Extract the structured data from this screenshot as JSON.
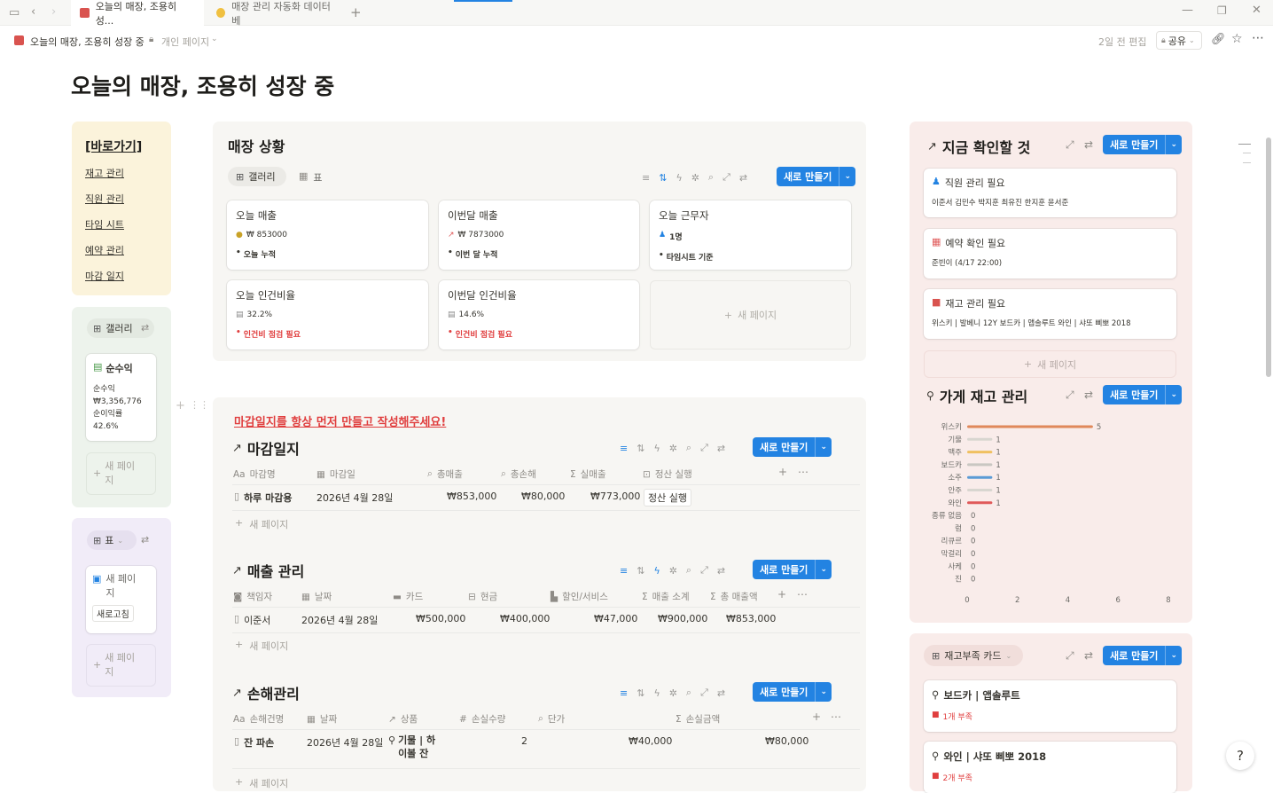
{
  "tabs": [
    {
      "label": "오늘의 매장, 조용히 성...",
      "active": true
    },
    {
      "label": "매장 관리 자동화 데이터베",
      "active": false
    }
  ],
  "topbar": {
    "page": "오늘의 매장, 조용히 성장 중",
    "privacy": "개인 페이지",
    "edited": "2일 전 편집",
    "share": "공유"
  },
  "title": "오늘의 매장, 조용히 성장 중",
  "shortcuts": {
    "heading": "[바로가기]",
    "links": [
      "재고 관리",
      "직원 관리",
      "타임 시트",
      "예약 관리",
      "마감 일지"
    ]
  },
  "gallery1": {
    "view": "갤러리",
    "card_title": "순수익",
    "lines": [
      "순수익",
      "₩3,356,776",
      "순이익률",
      "42.6%"
    ],
    "new": "새 페이\n지"
  },
  "gallery2": {
    "view": "표",
    "card_title": "새 페이\n지",
    "refresh": "새로고침",
    "new": "새 페이\n지"
  },
  "status": {
    "heading": "매장 상황",
    "views": [
      "갤러리",
      "표"
    ],
    "new_btn": "새로 만들기",
    "cards": [
      {
        "title": "오늘 매출",
        "value": "₩ 853000",
        "note": "오늘 누적",
        "alert": false,
        "icon": "coin-icon"
      },
      {
        "title": "이번달 매출",
        "value": "₩ 7873000",
        "note": "이번 달 누적",
        "alert": false,
        "icon": "chart-up-icon"
      },
      {
        "title": "오늘 근무자",
        "value": "1명",
        "note": "타임시트 기준",
        "alert": false,
        "icon": "people-icon"
      },
      {
        "title": "오늘 인건비율",
        "value": "32.2%",
        "note": "인건비 점검 필요",
        "alert": true,
        "icon": "memo-icon"
      },
      {
        "title": "이번달 인건비율",
        "value": "14.6%",
        "note": "인건비 점검 필요",
        "alert": true,
        "icon": "memo-icon"
      }
    ],
    "new_page": "새 페이지"
  },
  "notice": "마감일지를 항상 먼저 만들고 작성해주세요!",
  "closing": {
    "heading": "마감일지",
    "new_btn": "새로 만들기",
    "cols": [
      "마감명",
      "마감일",
      "총매출",
      "총손해",
      "실매출",
      "정산 실행"
    ],
    "row": [
      "하루 마감용",
      "2026년 4월 28일",
      "₩853,000",
      "₩80,000",
      "₩773,000",
      "정산 실행"
    ],
    "new_page": "새 페이지"
  },
  "sales": {
    "heading": "매출 관리",
    "new_btn": "새로 만들기",
    "cols": [
      "책임자",
      "날짜",
      "카드",
      "현금",
      "할인/서비스",
      "매출 소계",
      "총 매출액"
    ],
    "row": [
      "이준서",
      "2026년 4월 28일",
      "₩500,000",
      "₩400,000",
      "₩47,000",
      "₩900,000",
      "₩853,000"
    ],
    "new_page": "새 페이지"
  },
  "loss": {
    "heading": "손해관리",
    "new_btn": "새로 만들기",
    "cols": [
      "손해건명",
      "날짜",
      "상품",
      "손실수량",
      "단가",
      "손실금액"
    ],
    "row": [
      "잔 파손",
      "2026년 4월 28일",
      "기물 | 하\n이볼 잔",
      "2",
      "₩40,000",
      "₩80,000"
    ],
    "new_page": "새 페이지"
  },
  "check": {
    "heading": "지금 확인할 것",
    "new_btn": "새로 만들기",
    "cards": [
      {
        "title": "직원 관리 필요",
        "sub": "이준서 김민수 박지훈 최유진 한지훈 윤서준",
        "icon": "people-icon"
      },
      {
        "title": "예약 확인 필요",
        "sub": "준빈이 (4/17 22:00)",
        "icon": "calendar-icon"
      },
      {
        "title": "재고 관리 필요",
        "sub": "위스키 | 발베니 12Y 보드카 | 앱솔루트 와인 | 샤또 삐뽀 2018",
        "icon": "alert-icon"
      }
    ],
    "new_page": "새 페이지"
  },
  "inventory": {
    "heading": "가게 재고 관리",
    "new_btn": "새로 만들기"
  },
  "chart_data": {
    "type": "bar",
    "orientation": "horizontal",
    "categories": [
      "위스키",
      "기물",
      "맥주",
      "보드카",
      "소주",
      "안주",
      "와인",
      "종류 없음",
      "럼",
      "리큐르",
      "막걸리",
      "사케",
      "진"
    ],
    "values": [
      5,
      1,
      1,
      1,
      1,
      1,
      1,
      0,
      0,
      0,
      0,
      0,
      0
    ],
    "colors": [
      "#e0885a",
      "#d8d6d0",
      "#f0c060",
      "#c9c7c2",
      "#5b9bd5",
      "#d8d6d0",
      "#e05a5a",
      "#d8d6d0",
      "#d8d6d0",
      "#d8d6d0",
      "#d8d6d0",
      "#d8d6d0",
      "#d8d6d0"
    ],
    "xlim": [
      0,
      8
    ],
    "xticks": [
      "0",
      "2",
      "4",
      "6",
      "8"
    ]
  },
  "shortage": {
    "view": "재고부족 카드",
    "new_btn": "새로 만들기",
    "cards": [
      {
        "title": "보드카 | 앱솔루트",
        "badge": "1개 부족"
      },
      {
        "title": "와인 | 샤또 삐뽀 2018",
        "badge": "2개 부족"
      }
    ]
  }
}
